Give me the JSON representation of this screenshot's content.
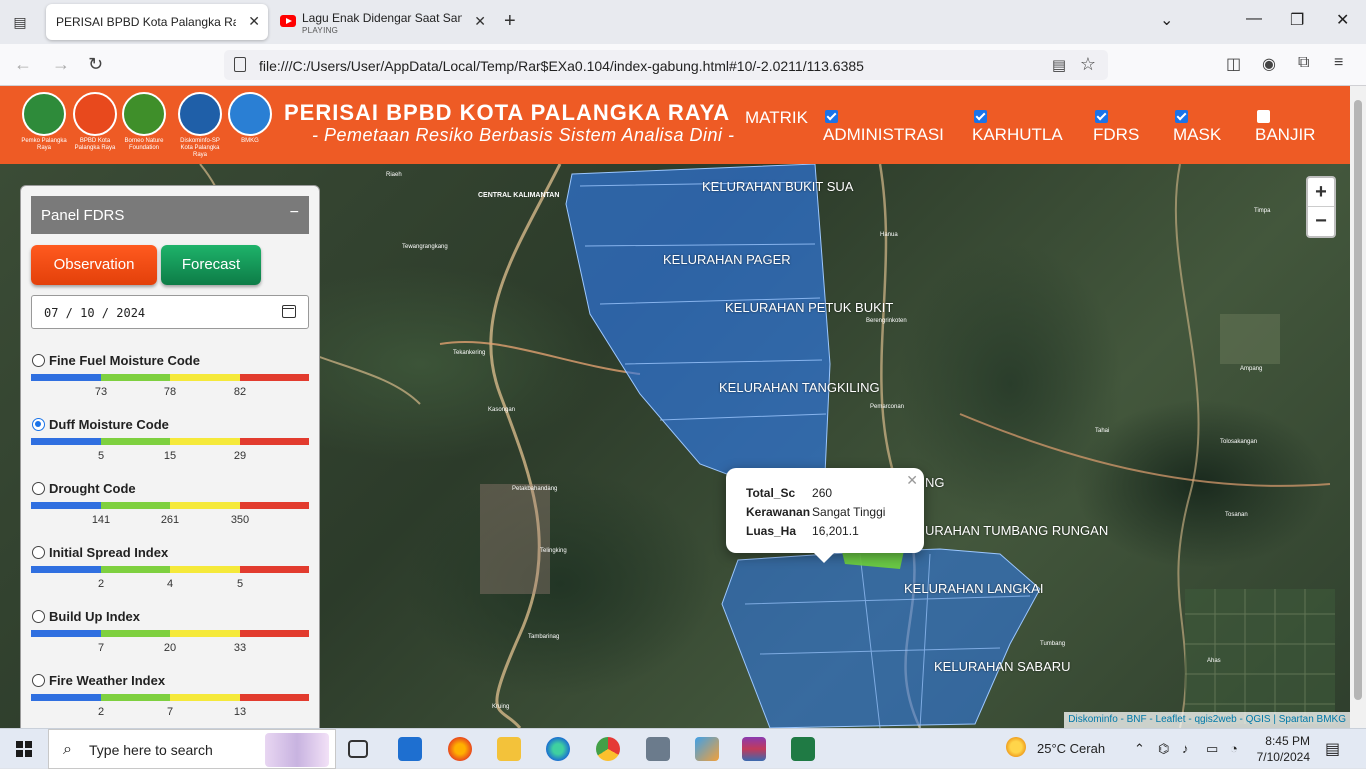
{
  "browser": {
    "tabs": [
      {
        "title": "PERISAI BPBD Kota Palangka Raya",
        "active": true
      },
      {
        "title": "Lagu Enak Didengar Saat Santai",
        "subtitle": "PLAYING",
        "active": false
      }
    ],
    "url": "file:///C:/Users/User/AppData/Local/Temp/Rar$EXa0.104/index-gabung.html#10/-2.0211/113.6385"
  },
  "header": {
    "logos": [
      {
        "label": "Pemko Palangka Raya",
        "color": "#2e8b3a"
      },
      {
        "label": "BPBD Kota Palangka Raya",
        "color": "#e8491d"
      },
      {
        "label": "Borneo Nature Foundation",
        "color": "#3f8f2a"
      },
      {
        "label": "Diskominfo-SP Kota Palangka Raya",
        "color": "#1f5fa8"
      },
      {
        "label": "BMKG",
        "color": "#2a7fd4"
      }
    ],
    "title": "PERISAI BPBD KOTA PALANGKA RAYA",
    "subtitle": "- Pemetaan Resiko Berbasis Sistem Analisa Dini -",
    "matrik": "MATRIK",
    "layers": [
      {
        "label": "ADMINISTRASI",
        "checked": true
      },
      {
        "label": "KARHUTLA",
        "checked": true
      },
      {
        "label": "FDRS",
        "checked": true
      },
      {
        "label": "MASK",
        "checked": true
      },
      {
        "label": "BANJIR",
        "checked": false
      }
    ]
  },
  "map": {
    "kelurahan": [
      "KELURAHAN BUKIT SUA",
      "KELURAHAN PAGER",
      "KELURAHAN PETUK BUKIT",
      "KELURAHAN TANGKILING",
      "NG",
      "URAHAN TUMBANG RUNGAN",
      "KELURAHAN LANGKAI",
      "KELURAHAN SABARU"
    ],
    "places": [
      "CENTRAL KALIMANTAN",
      "Tewangrangkang",
      "Tekankering",
      "Kasongan",
      "Petakbahandang",
      "Telingking",
      "Tambarinag",
      "Kruing",
      "Hanua",
      "Berengrinkoten",
      "Pemarconan",
      "Tahai",
      "Ampang",
      "Tolosakangan",
      "Tosanan",
      "Tumbang",
      "Ahas",
      "Timpa",
      "Riaeh"
    ],
    "popup": {
      "rows": [
        {
          "key": "Total_Sc",
          "value": "260"
        },
        {
          "key": "Kerawanan",
          "value": "Sangat Tinggi"
        },
        {
          "key": "Luas_Ha",
          "value": "16,201.1"
        }
      ]
    },
    "zoom_in": "+",
    "zoom_out": "−",
    "attribution": "Diskominfo - BNF - Leaflet - qgis2web - QGIS | Spartan BMKG"
  },
  "panel": {
    "title": "Panel FDRS",
    "collapse": "−",
    "observation": "Observation",
    "forecast": "Forecast",
    "date": "07 / 10 / 2024",
    "indices": [
      {
        "name": "Fine Fuel Moisture Code",
        "selected": false,
        "ticks": [
          "73",
          "78",
          "82"
        ]
      },
      {
        "name": "Duff Moisture Code",
        "selected": true,
        "ticks": [
          "5",
          "15",
          "29"
        ]
      },
      {
        "name": "Drought Code",
        "selected": false,
        "ticks": [
          "141",
          "261",
          "350"
        ]
      },
      {
        "name": "Initial Spread Index",
        "selected": false,
        "ticks": [
          "2",
          "4",
          "5"
        ]
      },
      {
        "name": "Build Up Index",
        "selected": false,
        "ticks": [
          "7",
          "20",
          "33"
        ]
      },
      {
        "name": "Fire Weather Index",
        "selected": false,
        "ticks": [
          "2",
          "7",
          "13"
        ]
      }
    ],
    "scale_colors": [
      "#2f6fe0",
      "#7ed03f",
      "#f5e93a",
      "#e23b2e"
    ]
  },
  "taskbar": {
    "search_placeholder": "Type here to search",
    "weather": "25°C  Cerah",
    "time": "8:45 PM",
    "date": "7/10/2024"
  }
}
